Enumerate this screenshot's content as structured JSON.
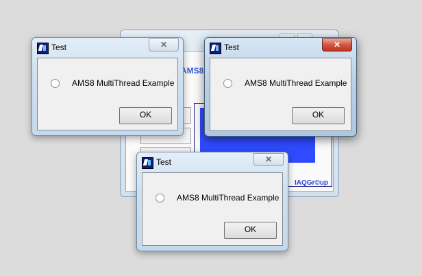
{
  "parent_window": {
    "title_fragment": "AMS8 M",
    "brand": "IAQGr©up"
  },
  "dialogs": [
    {
      "title": "Test",
      "radio_label": "AMS8 MultiThread Example",
      "ok_label": "OK",
      "close_glyph": "✕",
      "active": false
    },
    {
      "title": "Test",
      "radio_label": "AMS8 MultiThread Example",
      "ok_label": "OK",
      "close_glyph": "✕",
      "active": true
    },
    {
      "title": "Test",
      "radio_label": "AMS8 MultiThread Example",
      "ok_label": "OK",
      "close_glyph": "✕",
      "active": false
    }
  ],
  "colors": {
    "desktop": "#dcdcdc",
    "close_active": "#c2351f",
    "accent_blue": "#2e4bff"
  }
}
